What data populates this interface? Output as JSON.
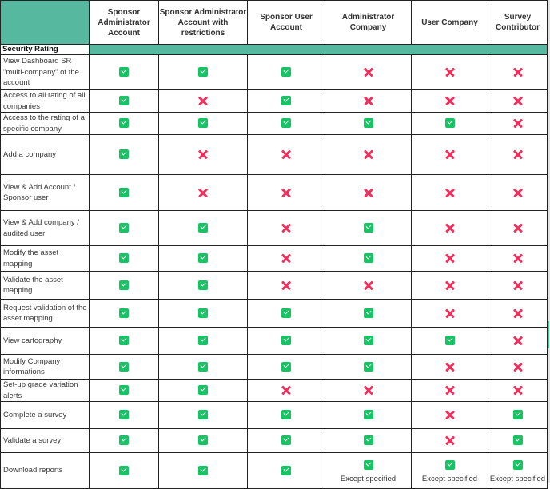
{
  "table": {
    "columns": [
      "Sponsor Administrator Account",
      "Sponsor Administrator Account with restrictions",
      "Sponsor User Account",
      "Administrator Company",
      "User Company",
      "Survey Contributor"
    ],
    "section_title": "Security Rating",
    "legend": {
      "yes": "check-icon",
      "no": "cross-icon"
    },
    "colors": {
      "header_accent": "#55b89f",
      "check": "#16c463",
      "cross": "#f0305c"
    },
    "rows": [
      {
        "feature": "View Dashboard SR \"multi-company\" of the account",
        "values": [
          "yes",
          "yes",
          "yes",
          "no",
          "no",
          "no"
        ],
        "notes": [
          "",
          "",
          "",
          "",
          "",
          ""
        ]
      },
      {
        "feature": "Access to all rating of all companies",
        "values": [
          "yes",
          "no",
          "yes",
          "no",
          "no",
          "no"
        ],
        "notes": [
          "",
          "",
          "",
          "",
          "",
          ""
        ]
      },
      {
        "feature": "Access to the rating of a specific company",
        "values": [
          "yes",
          "yes",
          "yes",
          "yes",
          "yes",
          "no"
        ],
        "notes": [
          "",
          "",
          "",
          "",
          "",
          ""
        ]
      },
      {
        "feature": "Add a company",
        "values": [
          "yes",
          "no",
          "no",
          "no",
          "no",
          "no"
        ],
        "notes": [
          "",
          "",
          "",
          "",
          "",
          ""
        ]
      },
      {
        "feature": "View & Add Account / Sponsor user",
        "values": [
          "yes",
          "no",
          "no",
          "no",
          "no",
          "no"
        ],
        "notes": [
          "",
          "",
          "",
          "",
          "",
          ""
        ]
      },
      {
        "feature": "View & Add company / audited user",
        "values": [
          "yes",
          "yes",
          "no",
          "yes",
          "no",
          "no"
        ],
        "notes": [
          "",
          "",
          "",
          "",
          "",
          ""
        ]
      },
      {
        "feature": "Modify the asset mapping",
        "values": [
          "yes",
          "yes",
          "no",
          "yes",
          "no",
          "no"
        ],
        "notes": [
          "",
          "",
          "",
          "",
          "",
          ""
        ]
      },
      {
        "feature": "Validate the asset mapping",
        "values": [
          "yes",
          "yes",
          "no",
          "no",
          "no",
          "no"
        ],
        "notes": [
          "",
          "",
          "",
          "",
          "",
          ""
        ]
      },
      {
        "feature": "Request validation of the asset mapping",
        "values": [
          "yes",
          "yes",
          "yes",
          "yes",
          "no",
          "no"
        ],
        "notes": [
          "",
          "",
          "",
          "",
          "",
          ""
        ]
      },
      {
        "feature": "View cartography",
        "values": [
          "yes",
          "yes",
          "yes",
          "yes",
          "yes",
          "no"
        ],
        "notes": [
          "",
          "",
          "",
          "",
          "",
          ""
        ]
      },
      {
        "feature": "Modify Company informations",
        "values": [
          "yes",
          "yes",
          "yes",
          "yes",
          "no",
          "no"
        ],
        "notes": [
          "",
          "",
          "",
          "",
          "",
          ""
        ]
      },
      {
        "feature": "Set-up grade variation alerts",
        "values": [
          "yes",
          "yes",
          "no",
          "no",
          "no",
          "no"
        ],
        "notes": [
          "",
          "",
          "",
          "",
          "",
          ""
        ]
      },
      {
        "feature": "Complete a survey",
        "values": [
          "yes",
          "yes",
          "yes",
          "yes",
          "no",
          "yes"
        ],
        "notes": [
          "",
          "",
          "",
          "",
          "",
          ""
        ]
      },
      {
        "feature": "Validate a survey",
        "values": [
          "yes",
          "yes",
          "yes",
          "yes",
          "no",
          "yes"
        ],
        "notes": [
          "",
          "",
          "",
          "",
          "",
          ""
        ]
      },
      {
        "feature": "Download reports",
        "values": [
          "yes",
          "yes",
          "yes",
          "yes",
          "yes",
          "yes"
        ],
        "notes": [
          "",
          "",
          "",
          "Except specified",
          "Except specified",
          "Except specified"
        ]
      }
    ]
  }
}
